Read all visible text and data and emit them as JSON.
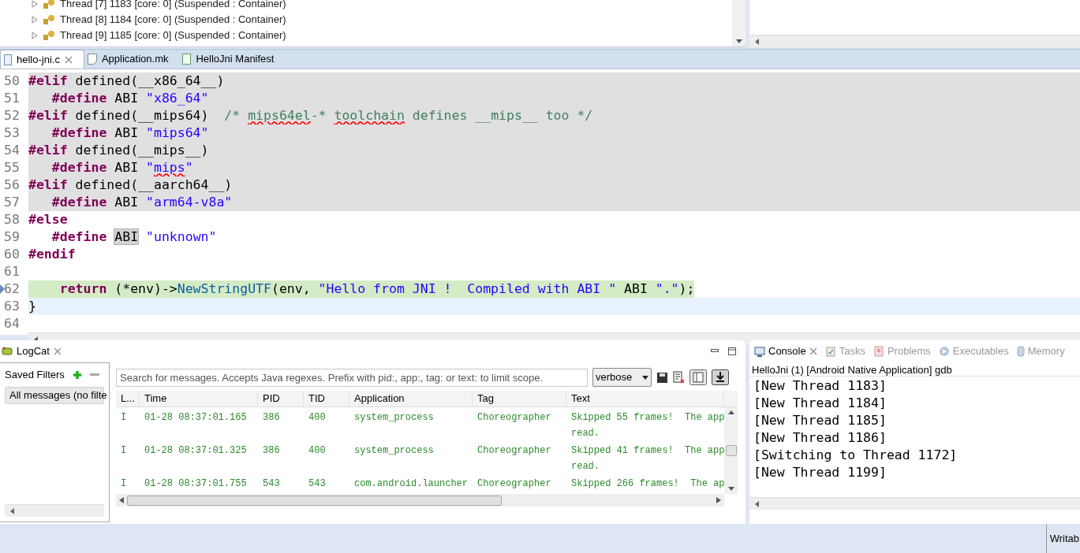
{
  "debug_tree": {
    "rows": [
      {
        "expanded": false,
        "label": "Thread [7] 1183 [core: 0] (Suspended : Container)"
      },
      {
        "expanded": false,
        "label": "Thread [8] 1184 [core: 0] (Suspended : Container)"
      },
      {
        "expanded": false,
        "label": "Thread [9] 1185 [core: 0] (Suspended : Container)"
      }
    ]
  },
  "editor": {
    "tabs": [
      {
        "label": "hello-jni.c",
        "kind": "c",
        "selected": true
      },
      {
        "label": "Application.mk",
        "kind": "mk",
        "selected": false
      },
      {
        "label": "HelloJni Manifest",
        "kind": "manifest",
        "selected": false
      }
    ],
    "lines": [
      {
        "number": "50",
        "kind": "inactive",
        "tokens": [
          {
            "text": "#elif",
            "kind": "keyword"
          },
          {
            "text": " defined(__x86_64__)",
            "kind": "plain"
          }
        ]
      },
      {
        "number": "51",
        "kind": "inactive",
        "tokens": [
          {
            "text": "   #define",
            "kind": "keyword"
          },
          {
            "text": " ABI ",
            "kind": "plain"
          },
          {
            "text": "\"x86_64\"",
            "kind": "string"
          }
        ]
      },
      {
        "number": "52",
        "kind": "inactive",
        "tokens": [
          {
            "text": "#elif",
            "kind": "keyword"
          },
          {
            "text": " defined(__mips64)  ",
            "kind": "plain"
          },
          {
            "text": "/* ",
            "kind": "comment"
          },
          {
            "text": "mips64el",
            "kind": "comment_typo"
          },
          {
            "text": "-* ",
            "kind": "comment"
          },
          {
            "text": "toolchain",
            "kind": "comment_typo"
          },
          {
            "text": " defines __mips__ too */",
            "kind": "comment"
          }
        ]
      },
      {
        "number": "53",
        "kind": "inactive",
        "tokens": [
          {
            "text": "   #define",
            "kind": "keyword"
          },
          {
            "text": " ABI ",
            "kind": "plain"
          },
          {
            "text": "\"mips64\"",
            "kind": "string"
          }
        ]
      },
      {
        "number": "54",
        "kind": "inactive",
        "tokens": [
          {
            "text": "#elif",
            "kind": "keyword"
          },
          {
            "text": " defined(__mips__)",
            "kind": "plain"
          }
        ]
      },
      {
        "number": "55",
        "kind": "inactive",
        "tokens": [
          {
            "text": "   #define",
            "kind": "keyword"
          },
          {
            "text": " ABI ",
            "kind": "plain"
          },
          {
            "text": "\"",
            "kind": "string"
          },
          {
            "text": "mips",
            "kind": "string_typo"
          },
          {
            "text": "\"",
            "kind": "string"
          }
        ]
      },
      {
        "number": "56",
        "kind": "inactive",
        "tokens": [
          {
            "text": "#elif",
            "kind": "keyword"
          },
          {
            "text": " defined(__aarch64__)",
            "kind": "plain"
          }
        ]
      },
      {
        "number": "57",
        "kind": "inactive",
        "tokens": [
          {
            "text": "   #define",
            "kind": "keyword"
          },
          {
            "text": " ABI ",
            "kind": "plain"
          },
          {
            "text": "\"arm64-v8a\"",
            "kind": "string"
          }
        ]
      },
      {
        "number": "58",
        "kind": "plain",
        "tokens": [
          {
            "text": "#else",
            "kind": "keyword"
          }
        ]
      },
      {
        "number": "59",
        "kind": "plain",
        "tokens": [
          {
            "text": "   #define ",
            "kind": "keyword"
          },
          {
            "text": "ABI",
            "kind": "occurrence"
          },
          {
            "text": " \"unknown\"",
            "kind": "string"
          }
        ]
      },
      {
        "number": "60",
        "kind": "plain",
        "tokens": [
          {
            "text": "#endif",
            "kind": "keyword"
          }
        ]
      },
      {
        "number": "61",
        "kind": "plain"
      },
      {
        "number": "62",
        "kind": "debug",
        "tokens": [
          {
            "text": "    return",
            "kind": "keyword"
          },
          {
            "text": " (*env)->",
            "kind": "plain"
          },
          {
            "text": "NewStringUTF",
            "kind": "function"
          },
          {
            "text": "(env, ",
            "kind": "plain"
          },
          {
            "text": "\"Hello from JNI !  Compiled with ABI \"",
            "kind": "string"
          },
          {
            "text": " ABI ",
            "kind": "plain"
          },
          {
            "text": "\".\"",
            "kind": "string"
          },
          {
            "text": ");",
            "kind": "plain"
          }
        ]
      },
      {
        "number": "63",
        "kind": "current",
        "tokens": [
          {
            "text": "}",
            "kind": "plain"
          }
        ]
      },
      {
        "number": "64",
        "kind": "plain"
      }
    ]
  },
  "logcat": {
    "tab": {
      "label": "LogCat",
      "selected": true
    },
    "saved_filters": {
      "title": "Saved Filters",
      "items": [
        {
          "label": "All messages (no filte",
          "selected": true
        }
      ]
    },
    "search": {
      "placeholder": "Search for messages. Accepts Java regexes. Prefix with pid:, app:, tag: or text: to limit scope."
    },
    "level_select": "verbose",
    "scroll_lock": true,
    "table": {
      "columns": [
        "L...",
        "Time",
        "PID",
        "TID",
        "Application",
        "Tag",
        "Text"
      ],
      "rows": [
        {
          "cells": [
            "I",
            "01-28 08:37:01.165",
            "386",
            "400",
            "system_process",
            "Choreographer",
            "Skipped 55 frames!  The app"
          ],
          "continued": "read."
        },
        {
          "cells": [
            "I",
            "01-28 08:37:01.325",
            "386",
            "400",
            "system_process",
            "Choreographer",
            "Skipped 41 frames!  The app"
          ],
          "continued": "read."
        },
        {
          "cells": [
            "I",
            "01-28 08:37:01.755",
            "543",
            "543",
            "com.android.launcher",
            "Choreographer",
            "Skipped 266 frames!  The ap"
          ]
        }
      ]
    }
  },
  "console": {
    "tabs": [
      {
        "label": "Console",
        "kind": "console",
        "selected": true
      },
      {
        "label": "Tasks",
        "kind": "tasks",
        "selected": false
      },
      {
        "label": "Problems",
        "kind": "problems",
        "selected": false
      },
      {
        "label": "Executables",
        "kind": "executables",
        "selected": false
      },
      {
        "label": "Memory",
        "kind": "memory",
        "selected": false
      }
    ],
    "process": "HelloJni (1) [Android Native Application] gdb",
    "output": [
      "[New Thread 1183]",
      "[New Thread 1184]",
      "[New Thread 1185]",
      "[New Thread 1186]",
      "[Switching to Thread 1172]",
      "[New Thread 1199]"
    ]
  },
  "status_bar": {
    "mode": "Writab"
  }
}
